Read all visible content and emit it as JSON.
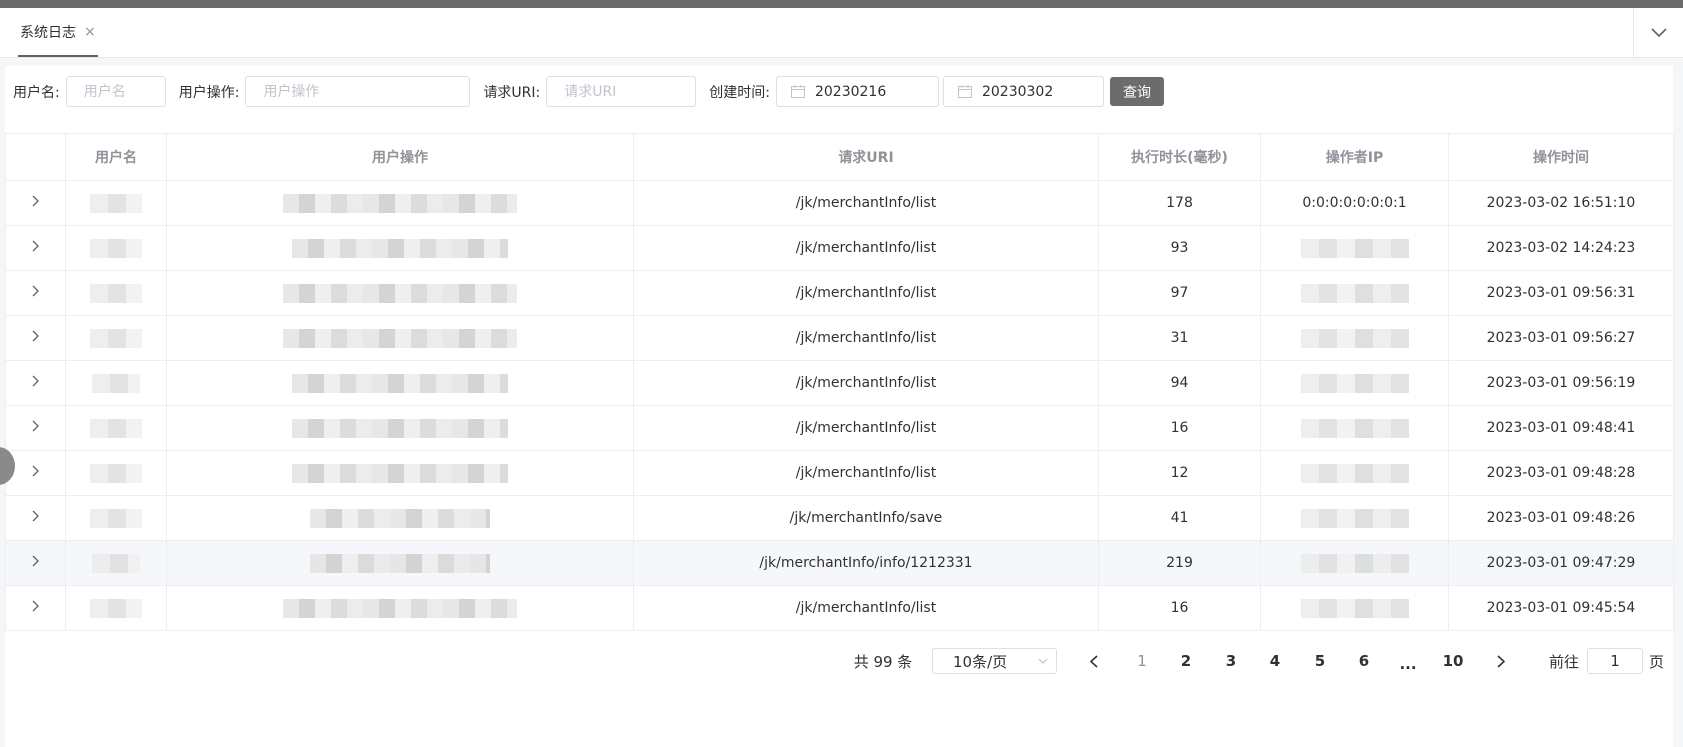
{
  "tabs": [
    {
      "label": "系统日志",
      "close": "×"
    }
  ],
  "filters": {
    "username_label": "用户名:",
    "username_placeholder": "用户名",
    "operation_label": "用户操作:",
    "operation_placeholder": "用户操作",
    "uri_label": "请求URI:",
    "uri_placeholder": "请求URI",
    "created_label": "创建时间:",
    "start_date": "20230216",
    "end_date": "20230302",
    "query_button": "查询"
  },
  "table": {
    "columns": [
      "用户名",
      "用户操作",
      "请求URI",
      "执行时长(毫秒)",
      "操作者IP",
      "操作时间"
    ],
    "rows": [
      {
        "uri": "/jk/merchantInfo/list",
        "duration": "178",
        "ip": "0:0:0:0:0:0:0:1",
        "time": "2023-03-02 16:51:10"
      },
      {
        "uri": "/jk/merchantInfo/list",
        "duration": "93",
        "ip": "",
        "time": "2023-03-02 14:24:23"
      },
      {
        "uri": "/jk/merchantInfo/list",
        "duration": "97",
        "ip": "",
        "time": "2023-03-01 09:56:31"
      },
      {
        "uri": "/jk/merchantInfo/list",
        "duration": "31",
        "ip": "",
        "time": "2023-03-01 09:56:27"
      },
      {
        "uri": "/jk/merchantInfo/list",
        "duration": "94",
        "ip": "",
        "time": "2023-03-01 09:56:19"
      },
      {
        "uri": "/jk/merchantInfo/list",
        "duration": "16",
        "ip": "",
        "time": "2023-03-01 09:48:41"
      },
      {
        "uri": "/jk/merchantInfo/list",
        "duration": "12",
        "ip": "",
        "time": "2023-03-01 09:48:28"
      },
      {
        "uri": "/jk/merchantInfo/save",
        "duration": "41",
        "ip": "",
        "time": "2023-03-01 09:48:26"
      },
      {
        "uri": "/jk/merchantInfo/info/1212331",
        "duration": "219",
        "ip": "",
        "time": "2023-03-01 09:47:29"
      },
      {
        "uri": "/jk/merchantInfo/list",
        "duration": "16",
        "ip": "",
        "time": "2023-03-01 09:45:54"
      }
    ]
  },
  "pagination": {
    "total": "共 99 条",
    "page_size": "10条/页",
    "pages": [
      "1",
      "2",
      "3",
      "4",
      "5",
      "6",
      "...",
      "10"
    ],
    "current": "1",
    "goto_label": "前往",
    "goto_value": "1",
    "goto_suffix": "页"
  }
}
